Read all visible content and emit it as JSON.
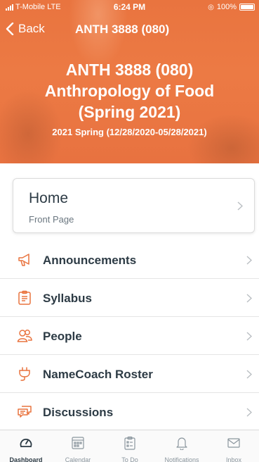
{
  "status_bar": {
    "carrier": "T-Mobile",
    "network": "LTE",
    "time": "6:24 PM",
    "battery": "100%"
  },
  "nav": {
    "back_label": "Back",
    "title": "ANTH 3888 (080)"
  },
  "course": {
    "code": "ANTH 3888 (080)",
    "name_line1": "Anthropology of Food",
    "name_line2": "(Spring 2021)",
    "term": "2021 Spring (12/28/2020-05/28/2021)",
    "header_color": "#e9743f"
  },
  "home": {
    "title": "Home",
    "subtitle": "Front Page"
  },
  "menu": [
    {
      "label": "Announcements",
      "icon": "megaphone-icon"
    },
    {
      "label": "Syllabus",
      "icon": "clipboard-icon"
    },
    {
      "label": "People",
      "icon": "people-icon"
    },
    {
      "label": "NameCoach Roster",
      "icon": "plug-icon"
    },
    {
      "label": "Discussions",
      "icon": "discussion-icon"
    }
  ],
  "tabs": [
    {
      "label": "Dashboard",
      "icon": "dashboard-icon",
      "active": true
    },
    {
      "label": "Calendar",
      "icon": "calendar-icon",
      "active": false
    },
    {
      "label": "To Do",
      "icon": "todo-icon",
      "active": false
    },
    {
      "label": "Notifications",
      "icon": "bell-icon",
      "active": false
    },
    {
      "label": "Inbox",
      "icon": "inbox-icon",
      "active": false
    }
  ],
  "colors": {
    "accent": "#e9743f",
    "text": "#2d3b45",
    "muted": "#8b969e"
  }
}
